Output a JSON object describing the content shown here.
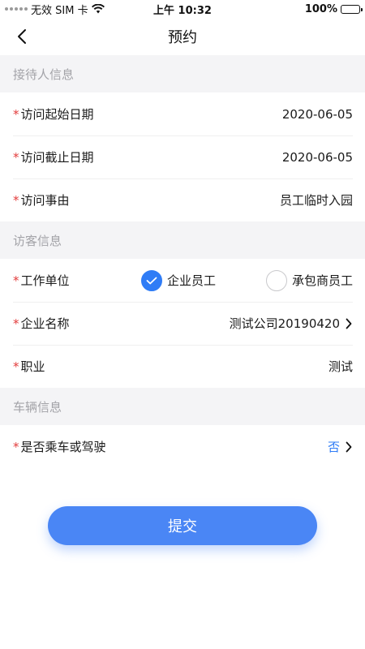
{
  "status_bar": {
    "carrier": "无效 SIM 卡",
    "time": "上午 10:32",
    "battery": "100%",
    "battery_level": 1.0,
    "icons": [
      "signal-dots-icon",
      "wifi-icon",
      "battery-icon"
    ]
  },
  "nav": {
    "title": "预约",
    "back_icon": "chevron-left-icon"
  },
  "sections": {
    "host_info": {
      "header": "接待人信息",
      "start_date": {
        "required": "*",
        "label": "访问起始日期",
        "value": "2020-06-05"
      },
      "end_date": {
        "required": "*",
        "label": "访问截止日期",
        "value": "2020-06-05"
      },
      "reason": {
        "required": "*",
        "label": "访问事由",
        "value": "员工临时入园"
      }
    },
    "visitor_info": {
      "header": "访客信息",
      "work_unit": {
        "required": "*",
        "label": "工作单位",
        "options": [
          {
            "label": "企业员工",
            "checked": true
          },
          {
            "label": "承包商员工",
            "checked": false
          }
        ]
      },
      "company_name": {
        "required": "*",
        "label": "企业名称",
        "value": "测试公司20190420"
      },
      "occupation": {
        "required": "*",
        "label": "职业",
        "value": "测试"
      }
    },
    "vehicle_info": {
      "header": "车辆信息",
      "driving": {
        "required": "*",
        "label": "是否乘车或驾驶",
        "value": "否"
      }
    }
  },
  "submit_label": "提交",
  "colors": {
    "accent": "#2f7cf6",
    "button": "#4a86f5",
    "required": "#e23b3b",
    "section_bg": "#f4f4f6",
    "section_text": "#a3a3a8"
  }
}
